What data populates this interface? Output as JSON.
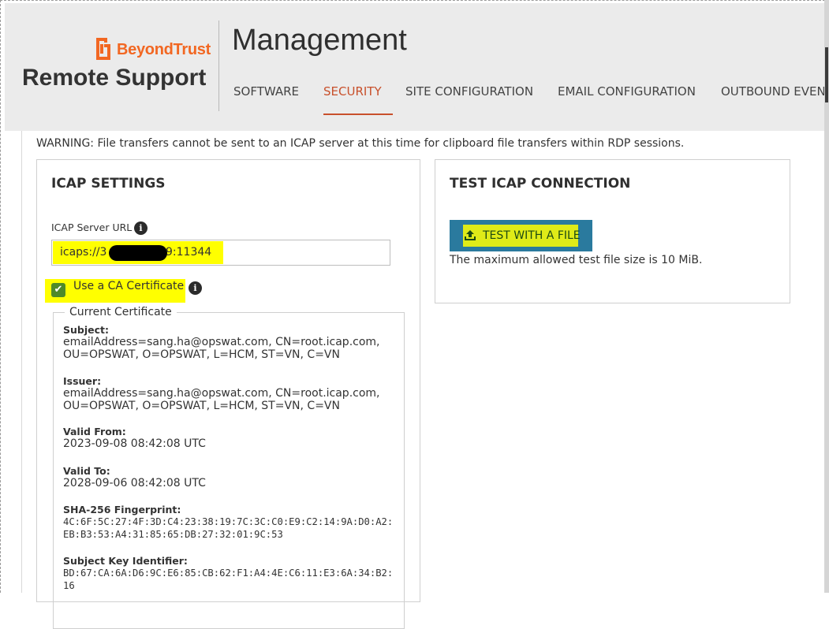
{
  "brand": {
    "company": "BeyondTrust",
    "product": "Remote Support",
    "brand_color": "#f26722"
  },
  "header": {
    "title": "Management",
    "tabs": [
      {
        "label": "SOFTWARE",
        "active": false
      },
      {
        "label": "SECURITY",
        "active": true
      },
      {
        "label": "SITE CONFIGURATION",
        "active": false
      },
      {
        "label": "EMAIL CONFIGURATION",
        "active": false
      },
      {
        "label": "OUTBOUND EVEN",
        "active": false
      }
    ],
    "active_color": "#c8502b"
  },
  "warning": "WARNING: File transfers cannot be sent to an ICAP server at this time for clipboard file transfers within RDP sessions.",
  "icap_settings": {
    "title": "ICAP SETTINGS",
    "server_url_label": "ICAP Server URL",
    "server_url_start": "icaps://3",
    "server_url_end": "9:11344",
    "use_ca_label": "Use a CA Certificate",
    "use_ca_checked": true,
    "certificate": {
      "legend": "Current Certificate",
      "subject_label": "Subject:",
      "subject_value": "emailAddress=sang.ha@opswat.com, CN=root.icap.com, OU=OPSWAT, O=OPSWAT, L=HCM, ST=VN, C=VN",
      "issuer_label": "Issuer:",
      "issuer_value": "emailAddress=sang.ha@opswat.com, CN=root.icap.com, OU=OPSWAT, O=OPSWAT, L=HCM, ST=VN, C=VN",
      "valid_from_label": "Valid From:",
      "valid_from_value": "2023-09-08 08:42:08 UTC",
      "valid_to_label": "Valid To:",
      "valid_to_value": "2028-09-06 08:42:08 UTC",
      "sha256_label": "SHA-256 Fingerprint:",
      "sha256_value": "4C:6F:5C:27:4F:3D:C4:23:38:19:7C:3C:C0:E9:C2:14:9A:D0:A2:EB:B3:53:A4:31:85:65:DB:27:32:01:9C:53",
      "ski_label": "Subject Key Identifier:",
      "ski_value": "BD:67:CA:6A:D6:9C:E6:85:CB:62:F1:A4:4E:C6:11:E3:6A:34:B2:16"
    }
  },
  "test_icap": {
    "title": "TEST ICAP CONNECTION",
    "button_label": "TEST WITH A FILE",
    "note": "The maximum allowed test file size is 10 MiB."
  }
}
